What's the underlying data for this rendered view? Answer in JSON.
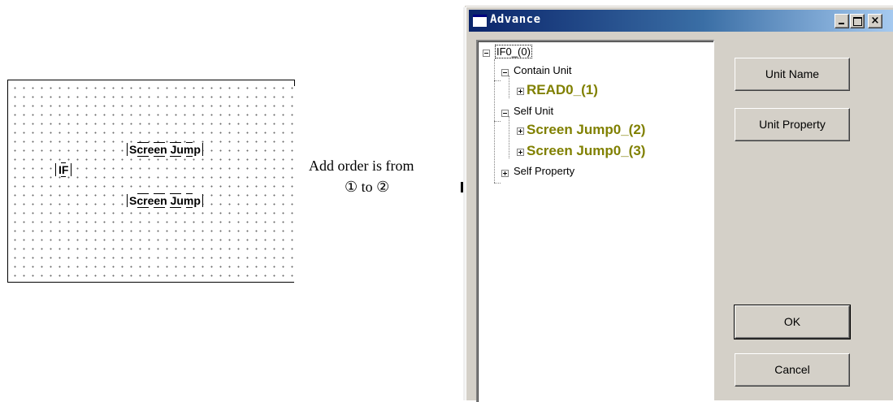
{
  "canvas": {
    "parts": [
      {
        "label": "IF"
      },
      {
        "label": "Screen Jump"
      },
      {
        "label": "Screen Jump"
      }
    ]
  },
  "note": {
    "line1": "Add order is from",
    "line2": "① to ②"
  },
  "dialog": {
    "title": "Advance",
    "window_buttons": {
      "minimize": "_",
      "maximize": "□",
      "close": "×"
    },
    "tree": {
      "root": "IF0_(0)",
      "contain_unit": "Contain Unit",
      "contain_children": [
        "READ0_(1)"
      ],
      "self_unit": "Self Unit",
      "self_children": [
        "Screen Jump0_(2)",
        "Screen Jump0_(3)"
      ],
      "self_property": "Self Property"
    },
    "buttons": {
      "unit_name": "Unit Name",
      "unit_property": "Unit Property",
      "ok": "OK",
      "cancel": "Cancel"
    }
  }
}
